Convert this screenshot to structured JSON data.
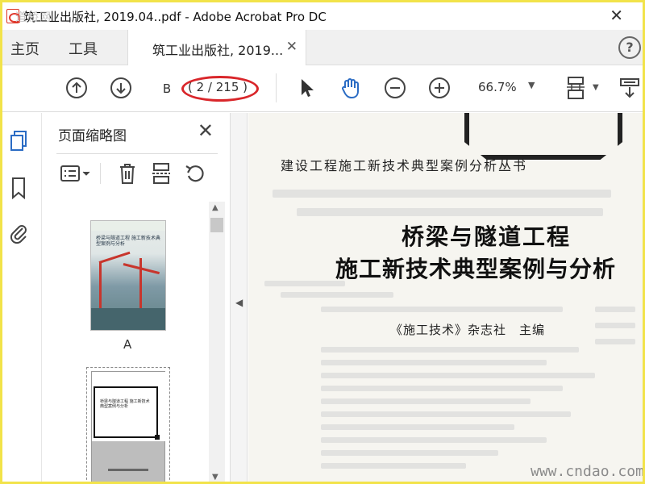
{
  "window": {
    "title": "筑工业出版社, 2019.04..pdf - Adobe Acrobat Pro DC",
    "close_glyph": "✕",
    "watermark_logo_text": "道桥网"
  },
  "tabs": {
    "home": "主页",
    "tools": "工具",
    "document_tab": "筑工业出版社, 2019...",
    "document_tab_close": "✕",
    "help": "?"
  },
  "toolbar": {
    "page_label": "B",
    "page_count": "( 2 / 215 )",
    "zoom": "66.7%",
    "icons": [
      "arrow-up-circle-icon",
      "arrow-down-circle-icon",
      "pointer-icon",
      "hand-icon",
      "zoom-out-icon",
      "zoom-in-icon",
      "page-fit-icon",
      "more-tools-icon"
    ]
  },
  "rail": {
    "icons": [
      "pages-icon",
      "bookmark-icon",
      "attachment-icon"
    ]
  },
  "thumbnail_panel": {
    "title": "页面缩略图",
    "close": "✕",
    "tools": [
      "options-menu-icon",
      "delete-icon",
      "insert-page-icon",
      "rotate-icon"
    ],
    "thumbnails": [
      {
        "label": "A",
        "cover_text": "桥梁与隧道工程 施工新技术典型案例与分析"
      },
      {
        "label": "",
        "cover_text": "桥梁与隧道工程 施工新技术典型案例与分析"
      }
    ]
  },
  "document": {
    "series_title": "建设工程施工新技术典型案例分析丛书",
    "main_title_line1": "桥梁与隧道工程",
    "main_title_line2": "施工新技术典型案例与分析",
    "editor": "《施工技术》杂志社　主编",
    "watermark_site": "www.cndao.com"
  },
  "colors": {
    "frame": "#f2e34a",
    "annotation": "#d9262a",
    "accent_blue": "#2b6cc4"
  }
}
